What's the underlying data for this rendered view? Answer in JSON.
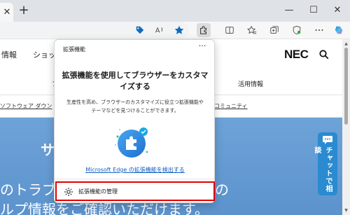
{
  "browser": {
    "new_tab_glyph": "+",
    "close_tab_glyph": "✕",
    "window_controls": {
      "minimize": "—",
      "maximize": "☐",
      "close": "✕"
    }
  },
  "toolbar": {
    "icons": [
      "extension-tag-icon",
      "read-aloud-icon",
      "favorite-star-icon",
      "extensions-puzzle-icon",
      "split-screen-icon",
      "favorites-icon",
      "collections-icon",
      "browser-essentials-icon",
      "copilot-icon"
    ]
  },
  "page": {
    "nav_left_1": "情報",
    "nav_left_2": "ショッ",
    "logo": "NEC",
    "menu_item": "活用情報",
    "menu_left_fragment": "フ",
    "link_left": "ソフトウェア ダウン",
    "link_right": "コミュニティ",
    "hero_fragment_top": "サ",
    "hero_line_1": "のトラブル",
    "hero_line_2": "ルプ情報をご確認いただけます。",
    "hero_right_paren": "の",
    "chat_tab": "チャットで相談"
  },
  "flyout": {
    "title": "拡張機能",
    "more_glyph": "···",
    "heading": "拡張機能を使用してブラウザーをカスタマイズする",
    "body": "生産性を高め、ブラウザーのカスタマイズに役立つ拡張機能やテーマなどを見つけることができます。",
    "link": "Microsoft Edge の拡張機能を検出する",
    "manage_label": "拡張機能の管理"
  },
  "colors": {
    "accent_blue": "#0f5fc2",
    "highlight_red": "#e00000",
    "hero_blue": "#6ea3d8",
    "chat_blue": "#2a8bd0"
  }
}
